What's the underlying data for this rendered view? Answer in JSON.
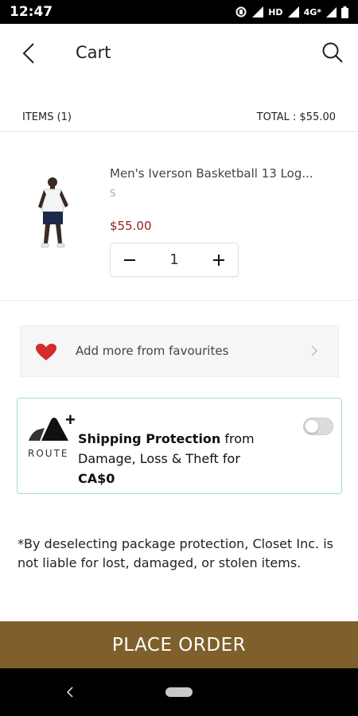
{
  "status_bar": {
    "time": "12:47",
    "network": "HD",
    "signal_label": "4G*"
  },
  "header": {
    "title": "Cart",
    "back_icon": "chevron-left-icon",
    "search_icon": "search-icon"
  },
  "summary": {
    "items_label": "ITEMS (1)",
    "total_label": "TOTAL : $55.00"
  },
  "cart": {
    "items": [
      {
        "name": "Men's Iverson Basketball 13 Log...",
        "size": "S",
        "price": "$55.00",
        "quantity": "1"
      }
    ],
    "price_color": "#9b1b1b"
  },
  "favourites": {
    "label": "Add more from favourites",
    "heart_color": "#d62b2b"
  },
  "route": {
    "brand": "ROUTE",
    "title_bold": "Shipping Protection",
    "title_rest": " from Damage, Loss & Theft for ",
    "price": "CA$0",
    "toggle_on": false,
    "border_color": "#a6d8dd"
  },
  "disclaimer": "*By deselecting package protection, Closet Inc. is not liable for lost, damaged, or stolen items.",
  "place_order": {
    "label": "PLACE ORDER",
    "color": "#7f5f2b"
  }
}
